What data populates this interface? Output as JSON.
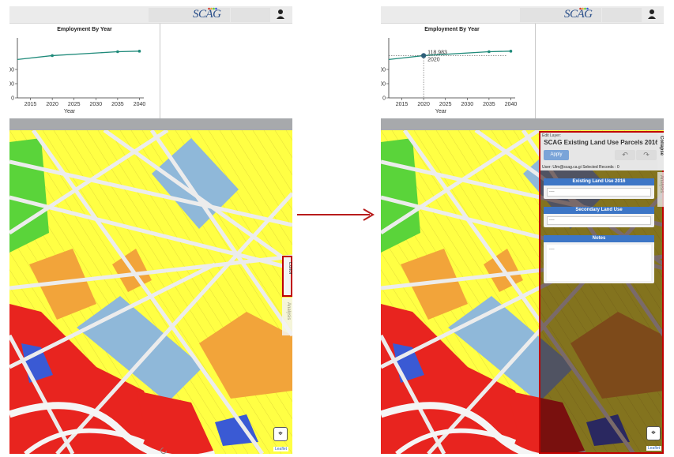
{
  "app": {
    "logo_text": "SCAG"
  },
  "left_view": {
    "chart_title": "Employment By Year",
    "tabs": {
      "edit": "Editor",
      "analysis": "Analysis"
    },
    "leaflet": "Leaflet"
  },
  "right_view": {
    "chart_title": "Employment By Year",
    "tooltip_value": "118,983",
    "tooltip_year": "2020",
    "edit_panel": {
      "edit_layer_label": "Edit Layer:",
      "layer_title": "SCAG Existing Land Use Parcels 2016",
      "apply_label": "Apply",
      "undo_icon": "↶",
      "redo_icon": "↷",
      "user_line": "User: Ulm@scag.ca.gi  Selected Records : 0",
      "cards": [
        {
          "title": "Existing Land Use 2016",
          "value": "----"
        },
        {
          "title": "Secondary Land Use",
          "value": "----"
        },
        {
          "title": "Notes",
          "value": "----"
        }
      ]
    },
    "tabs": {
      "collapse": "Collapse",
      "analysis": "Analysis"
    },
    "leaflet": "Leaflet"
  },
  "chart_data": [
    {
      "type": "line",
      "title": "Employment By Year",
      "xlabel": "Year",
      "ylabel": "",
      "x": [
        2012,
        2020,
        2035,
        2040
      ],
      "values": [
        108000,
        118983,
        130000,
        131500
      ],
      "xticks": [
        "2015",
        "2020",
        "2025",
        "2030",
        "2035",
        "2040"
      ],
      "yticks_left_view": [
        "000",
        "00",
        "0"
      ],
      "yticks_right_view": [
        ",000",
        ",000",
        "0"
      ],
      "color": "#1f8a7a"
    }
  ],
  "colors": {
    "residential": "#ffff44",
    "commercial": "#e8241f",
    "institutional": "#8fb8d9",
    "orange_use": "#f2a43a",
    "park": "#5ad43a",
    "industrial": "#3a5ad4",
    "highlight_border": "#c00000",
    "card_header": "#3d76c6"
  }
}
